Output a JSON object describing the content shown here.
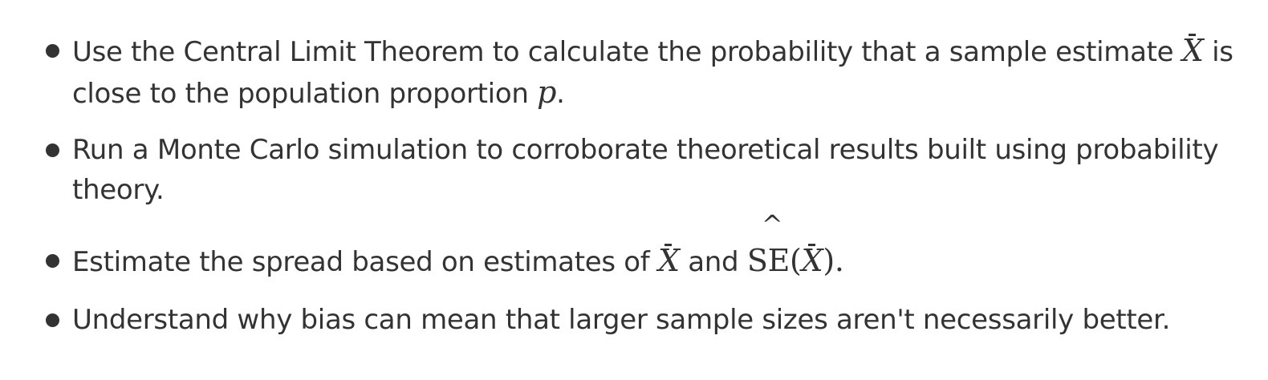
{
  "objectives": [
    {
      "part1": "Use the Central Limit Theorem to calculate the probability that a sample estimate",
      "xbar": "X",
      "part2": "is",
      "line2": "close to the population proportion",
      "p": "p",
      "end": "."
    },
    {
      "line1": "Run a Monte Carlo simulation to corroborate theoretical results built using probability",
      "line2": "theory."
    },
    {
      "part1": "Estimate the spread based on estimates of",
      "xbar": "X",
      "and": "and",
      "se_symbol": "SE",
      "hat": "^",
      "open": "(",
      "xbar2": "X",
      "close": ").",
      "end": ""
    },
    {
      "text": "Understand why bias can mean that larger sample sizes aren't necessarily better."
    }
  ]
}
